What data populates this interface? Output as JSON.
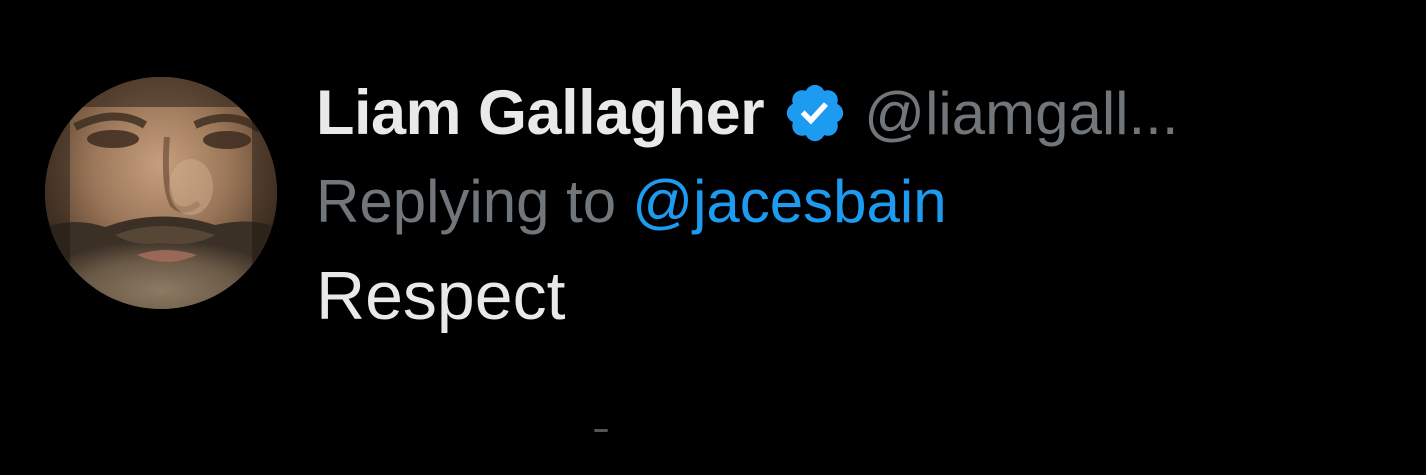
{
  "tweet": {
    "author": {
      "display_name": "Liam Gallagher",
      "handle": "@liamgall...",
      "avatar_icon": "avatar-photo",
      "verified_icon": "verified-badge-icon",
      "verified_color": "#1d9bf0"
    },
    "reply": {
      "label": "Replying to",
      "handle": "@jacesbain",
      "handle_color": "#1d9bf0"
    },
    "text": "Respect"
  },
  "colors": {
    "background": "#000000",
    "primary_text": "#e7e9ea",
    "secondary_text": "#71767b",
    "accent": "#1d9bf0"
  }
}
